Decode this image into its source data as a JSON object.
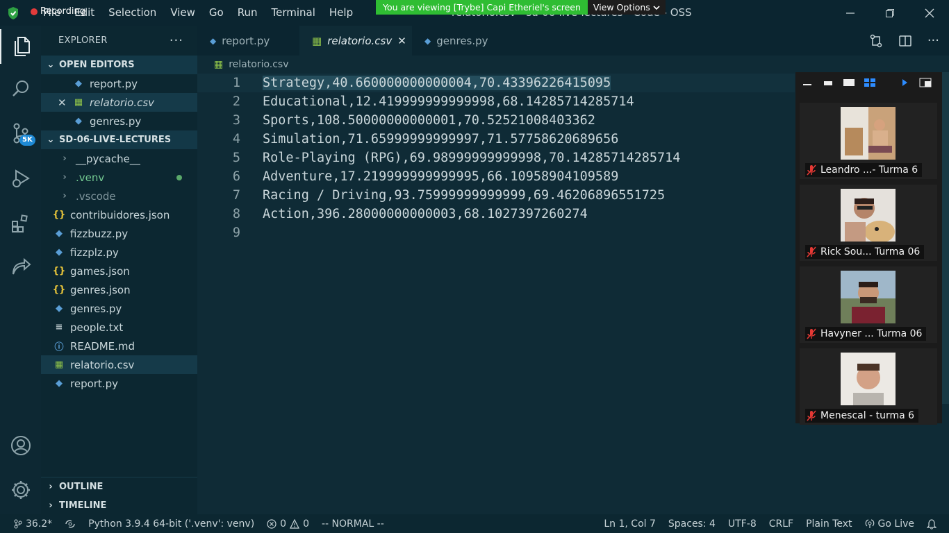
{
  "window": {
    "title": "relatorio.csv - sd-06-live-lectures - Code - OSS",
    "recording_label": "Recording"
  },
  "share_banner": {
    "text": "You are viewing [Trybe] Capi Etheriel's screen",
    "view_options": "View Options"
  },
  "menu": [
    "File",
    "Edit",
    "Selection",
    "View",
    "Go",
    "Run",
    "Terminal",
    "Help"
  ],
  "activity_bar": {
    "scm_badge": "5K"
  },
  "explorer": {
    "title": "EXPLORER",
    "open_editors": {
      "title": "OPEN EDITORS",
      "items": [
        {
          "name": "report.py",
          "icon": "python-icon"
        },
        {
          "name": "relatorio.csv",
          "icon": "csv-icon"
        },
        {
          "name": "genres.py",
          "icon": "python-icon"
        }
      ]
    },
    "workspace": {
      "title": "SD-06-LIVE-LECTURES",
      "folders": [
        "__pycache__",
        ".venv",
        ".vscode"
      ],
      "files": [
        {
          "name": "contribuidores.json",
          "icon": "{}"
        },
        {
          "name": "fizzbuzz.py",
          "icon": "py"
        },
        {
          "name": "fizzplz.py",
          "icon": "py"
        },
        {
          "name": "games.json",
          "icon": "{}"
        },
        {
          "name": "genres.json",
          "icon": "{}"
        },
        {
          "name": "genres.py",
          "icon": "py"
        },
        {
          "name": "people.txt",
          "icon": "≡"
        },
        {
          "name": "README.md",
          "icon": "md"
        },
        {
          "name": "relatorio.csv",
          "icon": "csv"
        },
        {
          "name": "report.py",
          "icon": "py"
        }
      ]
    },
    "outline": "OUTLINE",
    "timeline": "TIMELINE"
  },
  "tabs": [
    {
      "label": "report.py"
    },
    {
      "label": "relatorio.csv"
    },
    {
      "label": "genres.py"
    }
  ],
  "breadcrumb": "relatorio.csv",
  "editor": {
    "lines": [
      {
        "n": "1",
        "text": "Strategy,40.660000000000004,70.43396226415095"
      },
      {
        "n": "2",
        "text": "Educational,12.419999999999998,68.14285714285714"
      },
      {
        "n": "3",
        "text": "Sports,108.50000000000001,70.52521008403362"
      },
      {
        "n": "4",
        "text": "Simulation,71.65999999999997,71.57758620689656"
      },
      {
        "n": "5",
        "text": "Role-Playing (RPG),69.98999999999998,70.14285714285714"
      },
      {
        "n": "6",
        "text": "Adventure,17.219999999999995,66.10958904109589"
      },
      {
        "n": "7",
        "text": "Racing / Driving,93.75999999999999,69.46206896551725"
      },
      {
        "n": "8",
        "text": "Action,396.28000000000003,68.1027397260274"
      },
      {
        "n": "9",
        "text": ""
      }
    ]
  },
  "participants": [
    {
      "name": "Leandro ...- Turma 6"
    },
    {
      "name": "Rick Sou... Turma 06"
    },
    {
      "name": "Havyner ... Turma 06"
    },
    {
      "name": "Menescal - turma 6"
    }
  ],
  "statusbar": {
    "branch": "36.2*",
    "python": "Python 3.9.4 64-bit ('.venv': venv)",
    "errors": "0",
    "warnings": "0",
    "mode": "-- NORMAL --",
    "position": "Ln 1, Col 7",
    "spaces": "Spaces: 4",
    "encoding": "UTF-8",
    "eol": "CRLF",
    "language": "Plain Text",
    "golive": "Go Live"
  }
}
